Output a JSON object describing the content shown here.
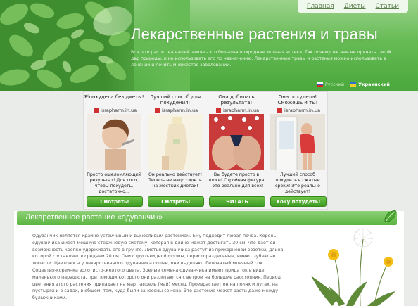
{
  "nav": {
    "items": [
      "Главная",
      "Диеты",
      "Статьи"
    ]
  },
  "header": {
    "title": "Лекарственные растения и травы",
    "intro": "Все, что растет на нашей земле - это большая природная зеленая аптека. Так почему же нам не принять такой дар природы, и не использовать его по назначению. Лекарственные травы и растения можно использовать в лечении и лечить множество заболеваний."
  },
  "languages": {
    "ru": "Русский",
    "ua": "Украинский"
  },
  "ads": [
    {
      "headline": "Я похудела без диеты!",
      "source": "israpharm.in.ua",
      "body": "Просто ошеломляющий результат! Для того, чтобы похудеть, достаточно...",
      "button": "Смотреть!"
    },
    {
      "headline": "Лучший способ для похудения!",
      "source": "israpharm.in.ua",
      "body": "Он реально действует! Теперь не надо сидеть на жестких диетах!",
      "button": "Смотреть!"
    },
    {
      "headline": "Она добилась результата!",
      "source": "israpharm.in.ua",
      "body": "Вы будете просто в шоке! Стройная фигура - это реально для всех!",
      "button": "ЧИТАТЬ"
    },
    {
      "headline": "Она похудела! Сможешь и ты!",
      "source": "israpharm.in.ua",
      "body": "Лучший способ похудеть в сжатые сроки! Это реально действует!",
      "button": "Хочу похудеть!"
    }
  ],
  "article": {
    "title": "Лекарственное растение «одуванчик»",
    "text": "Одуванчик является крайне устойчивым и выносливым растением. Ему подходит любая почва. Корень одуванчика имеет мощную стержневую систему, которая в длине может достигать 30 см, что дает ей возможность крепко удерживать его в грунте. Листья одуванчика растут из прикорневой розетки, длина которой составляет в среднем 20 см. Они струго-видной формы, перистораздельные, имеют зубчатые лопасти. Цветоносы у лекарственного одуванчика полые, они выделяют беловатый млечный сок. Соцветия-корзинка золотисто-желтого цвета. Зрелые семена одуванчика имеют придаток в виде маленького парашюта, при помощи которого они разлетаются с ветром на большие расстояния. Период цветения этого растения припадает на март-апрель (май) месяц. Произрастает он на полях и лугах, на пустырях и в садах, в общем, там, куда были занесены семена. Это растение может расти даже между булыжниками."
  },
  "colors": {
    "header_green": "#5ab43f",
    "button_green": "#3f9b23",
    "title_white": "#ffffff"
  }
}
